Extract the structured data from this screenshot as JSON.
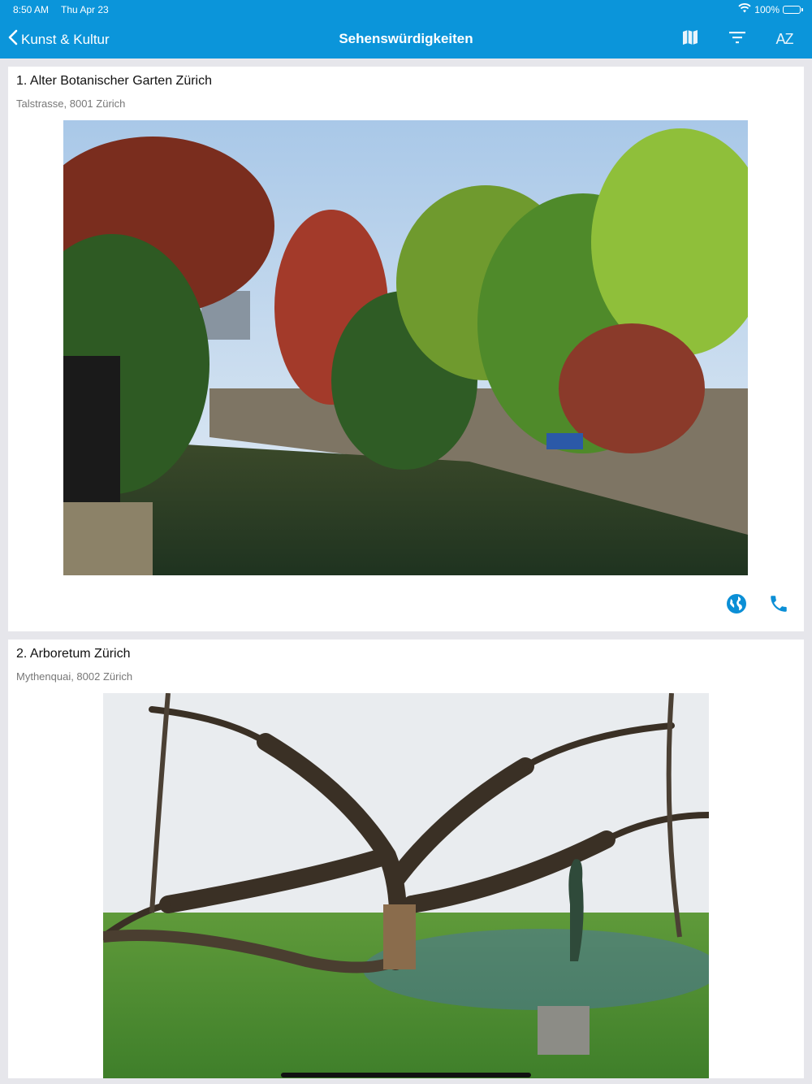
{
  "status_bar": {
    "time": "8:50 AM",
    "date": "Thu Apr 23",
    "battery": "100%"
  },
  "nav": {
    "back_label": "Kunst & Kultur",
    "title": "Sehenswürdigkeiten",
    "sort_label": "AZ"
  },
  "colors": {
    "brand": "#0b95da",
    "action": "#0b8fd6",
    "background": "#e6e6eb"
  },
  "icons": [
    "chevron-left-icon",
    "map-icon",
    "filter-icon",
    "sort-az-icon",
    "globe-icon",
    "phone-icon",
    "wifi-icon",
    "battery-icon"
  ],
  "places": [
    {
      "name": "1. Alter Botanischer Garten Zürich",
      "address": "Talstrasse, 8001 Zürich"
    },
    {
      "name": "2. Arboretum Zürich",
      "address": "Mythenquai, 8002  Zürich"
    }
  ]
}
